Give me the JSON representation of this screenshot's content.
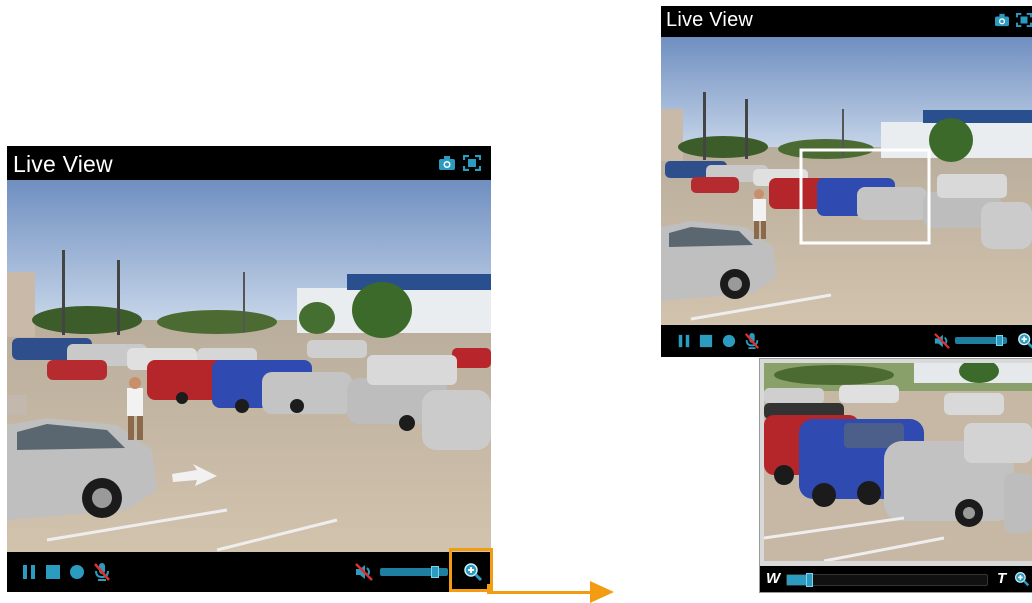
{
  "main_view": {
    "title": "Live View",
    "toolbar": {
      "snapshot_icon": "camera-icon",
      "fullscreen_icon": "fullscreen-icon"
    },
    "controls": {
      "pause_icon": "pause-icon",
      "stop_icon": "stop-icon",
      "record_icon": "record-icon",
      "mic_muted_icon": "mic-muted-icon",
      "speaker_muted_icon": "speaker-muted-icon",
      "volume_level": 0.85,
      "zoom_icon": "zoom-icon"
    }
  },
  "secondary_view": {
    "title": "Live View",
    "toolbar": {
      "snapshot_icon": "camera-icon",
      "fullscreen_icon": "fullscreen-icon"
    },
    "controls": {
      "pause_icon": "pause-icon",
      "stop_icon": "stop-icon",
      "record_icon": "record-icon",
      "mic_muted_icon": "mic-muted-icon",
      "speaker_muted_icon": "speaker-muted-icon",
      "volume_level": 0.9,
      "zoom_icon": "zoom-icon"
    }
  },
  "zoom_window": {
    "wide_label": "W",
    "tele_label": "T",
    "zoom_level": 0.1,
    "zoom_icon": "zoom-icon"
  },
  "colors": {
    "accent": "#f39c12",
    "control_blue": "#2b9bbf",
    "bar_bg": "#000000"
  }
}
